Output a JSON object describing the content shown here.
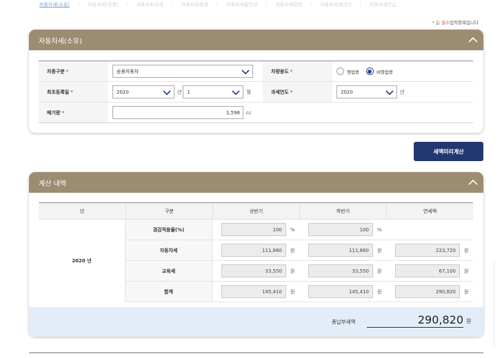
{
  "tabs": [
    "자동차세(소유)",
    "자동차세(주행)",
    "자동차취득세",
    "자동차등록세",
    "자동차세율안내",
    "자동차세감면",
    "자동차세계산기",
    "자동차세연납"
  ],
  "active_tab_index": 0,
  "required_note": {
    "star": "*",
    "prefix": "는",
    "emphasis": "필수",
    "suffix": "입력항목입니다"
  },
  "ownership_card": {
    "title": "자동차세(소유)",
    "fields": {
      "vehicle_type": {
        "label": "차종구분",
        "value": "승용자동차"
      },
      "usage": {
        "label": "차량용도",
        "options": [
          "영업용",
          "비영업용"
        ],
        "selected": "비영업용"
      },
      "first_registration": {
        "label": "최초등록일",
        "year": "2020",
        "year_unit": "년",
        "month": "1",
        "month_unit": "월"
      },
      "tax_year": {
        "label": "과세연도",
        "value": "2020",
        "unit": "년"
      },
      "displacement": {
        "label": "배기량",
        "value": "1,598",
        "unit": "cc"
      }
    },
    "required_mark": "*"
  },
  "calc_button": "세액미리계산",
  "result_card": {
    "title": "계산 내역",
    "headers": [
      "년",
      "구분",
      "상반기",
      "하반기",
      "연세액"
    ],
    "year": "2020 년",
    "rows": [
      {
        "kind": "경감적용율(%)",
        "first": "100",
        "second": "100",
        "annual": "",
        "unit": "%"
      },
      {
        "kind": "자동차세",
        "first": "111,860",
        "second": "111,860",
        "annual": "223,720",
        "unit": "원"
      },
      {
        "kind": "교육세",
        "first": "33,550",
        "second": "33,550",
        "annual": "67,100",
        "unit": "원"
      },
      {
        "kind": "합계",
        "first": "145,410",
        "second": "145,410",
        "annual": "290,820",
        "unit": "원"
      }
    ],
    "total_label": "총납부세액",
    "total_value": "290,820",
    "total_unit": "원"
  },
  "colors": {
    "card_header": "#9c8c70",
    "button": "#213870",
    "total_bg": "#e3edf7",
    "required": "#d9534f"
  }
}
